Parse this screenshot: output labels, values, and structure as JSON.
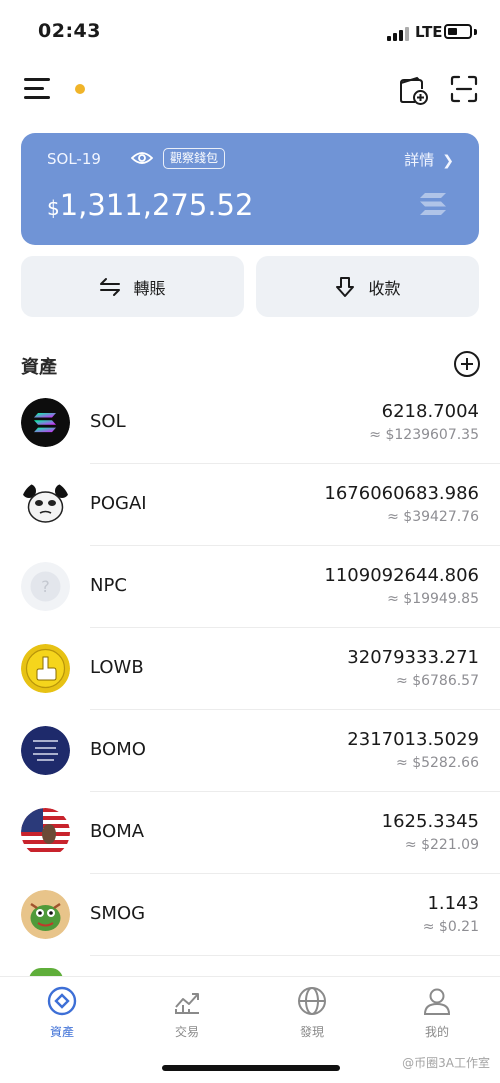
{
  "status": {
    "time": "02:43",
    "network": "LTE"
  },
  "wallet": {
    "name": "SOL-19",
    "watch_label": "觀察錢包",
    "details_label": "詳情",
    "currency_symbol": "$",
    "balance": "1,311,275.52",
    "card_color": "#7094d6"
  },
  "actions": {
    "transfer_label": "轉賬",
    "receive_label": "收款"
  },
  "assets": {
    "title": "資產",
    "items": [
      {
        "symbol": "SOL",
        "amount": "6218.7004",
        "value": "≈ $1239607.35",
        "icon": "solana-logo"
      },
      {
        "symbol": "POGAI",
        "amount": "1676060683.986",
        "value": "≈ $39427.76",
        "icon": "panda-meme-logo"
      },
      {
        "symbol": "NPC",
        "amount": "1109092644.806",
        "value": "≈ $19949.85",
        "icon": "unknown-token-logo"
      },
      {
        "symbol": "LOWB",
        "amount": "32079333.271",
        "value": "≈ $6786.57",
        "icon": "gold-coin-logo"
      },
      {
        "symbol": "BOMO",
        "amount": "2317013.5029",
        "value": "≈ $5282.66",
        "icon": "book-cover-logo"
      },
      {
        "symbol": "BOMA",
        "amount": "1625.3345",
        "value": "≈ $221.09",
        "icon": "us-flag-logo"
      },
      {
        "symbol": "SMOG",
        "amount": "1.143",
        "value": "≈ $0.21",
        "icon": "dragon-logo"
      }
    ]
  },
  "tabs": [
    {
      "label": "資產",
      "icon": "assets-icon",
      "active": true
    },
    {
      "label": "交易",
      "icon": "trade-chart-icon",
      "active": false
    },
    {
      "label": "發現",
      "icon": "globe-icon",
      "active": false
    },
    {
      "label": "我的",
      "icon": "profile-icon",
      "active": false
    }
  ],
  "watermark": "@币圈3A工作室",
  "colors": {
    "accent": "#3d6fd6",
    "notification_dot": "#f0b429"
  }
}
